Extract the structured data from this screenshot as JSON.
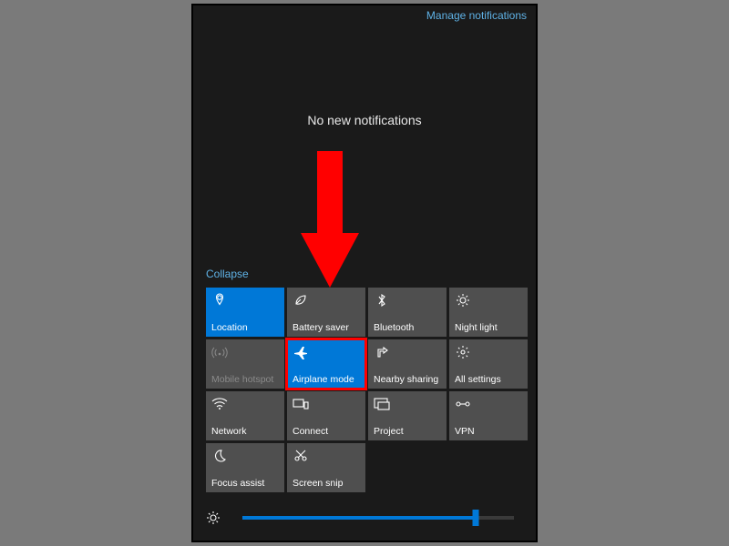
{
  "header": {
    "manage_link": "Manage notifications"
  },
  "body": {
    "no_notifications": "No new notifications"
  },
  "actions": {
    "collapse_label": "Collapse",
    "tiles": [
      {
        "id": "location",
        "label": "Location",
        "icon": "location-icon",
        "active": true,
        "disabled": false
      },
      {
        "id": "battery-saver",
        "label": "Battery saver",
        "icon": "leaf-icon",
        "active": false,
        "disabled": false
      },
      {
        "id": "bluetooth",
        "label": "Bluetooth",
        "icon": "bluetooth-icon",
        "active": false,
        "disabled": false
      },
      {
        "id": "night-light",
        "label": "Night light",
        "icon": "night-light-icon",
        "active": false,
        "disabled": false
      },
      {
        "id": "mobile-hotspot",
        "label": "Mobile hotspot",
        "icon": "hotspot-icon",
        "active": false,
        "disabled": true
      },
      {
        "id": "airplane-mode",
        "label": "Airplane mode",
        "icon": "airplane-icon",
        "active": true,
        "disabled": false
      },
      {
        "id": "nearby-sharing",
        "label": "Nearby sharing",
        "icon": "share-icon",
        "active": false,
        "disabled": false
      },
      {
        "id": "all-settings",
        "label": "All settings",
        "icon": "settings-icon",
        "active": false,
        "disabled": false
      },
      {
        "id": "network",
        "label": "Network",
        "icon": "wifi-icon",
        "active": false,
        "disabled": false
      },
      {
        "id": "connect",
        "label": "Connect",
        "icon": "connect-icon",
        "active": false,
        "disabled": false
      },
      {
        "id": "project",
        "label": "Project",
        "icon": "project-icon",
        "active": false,
        "disabled": false
      },
      {
        "id": "vpn",
        "label": "VPN",
        "icon": "vpn-icon",
        "active": false,
        "disabled": false
      },
      {
        "id": "focus-assist",
        "label": "Focus assist",
        "icon": "moon-icon",
        "active": false,
        "disabled": false
      },
      {
        "id": "screen-snip",
        "label": "Screen snip",
        "icon": "snip-icon",
        "active": false,
        "disabled": false
      }
    ]
  },
  "brightness": {
    "value_percent": 86
  },
  "annotation": {
    "arrow_color": "#ff0000",
    "highlight_color": "#ff0000",
    "highlighted_tile": "airplane-mode"
  }
}
